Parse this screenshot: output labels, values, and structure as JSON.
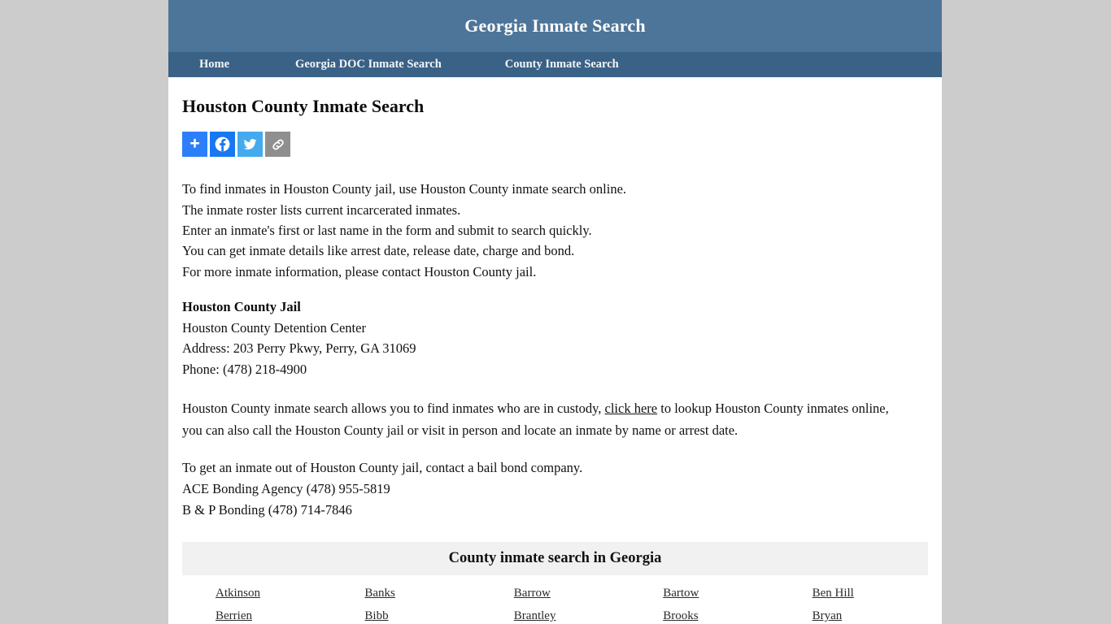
{
  "site": {
    "title": "Georgia Inmate Search",
    "header_bg": "#4d7599",
    "nav_bg": "#3a6186",
    "page_bg": "#cccccc"
  },
  "nav": {
    "items": [
      {
        "label": "Home"
      },
      {
        "label": "Georgia DOC Inmate Search"
      },
      {
        "label": "County Inmate Search"
      }
    ]
  },
  "main": {
    "page_title": "Houston County Inmate Search",
    "share_buttons": [
      {
        "name": "share-icon",
        "label": "Share",
        "color": "#2d7ff9"
      },
      {
        "name": "facebook-icon",
        "label": "Facebook",
        "color": "#1877f2"
      },
      {
        "name": "twitter-icon",
        "label": "Twitter",
        "color": "#44aaee"
      },
      {
        "name": "copy-link-icon",
        "label": "Copy Link",
        "color": "#8f8f8f"
      }
    ],
    "intro_lines": [
      "To find inmates in Houston County jail, use Houston County inmate search online.",
      "The inmate roster lists current incarcerated inmates.",
      "Enter an inmate's first or last name in the form and submit to search quickly.",
      "You can get inmate details like arrest date, release date, charge and bond.",
      "For more inmate information, please contact Houston County jail."
    ],
    "jail": {
      "name": "Houston County Jail",
      "facility": "Houston County Detention Center",
      "address": "Address: 203 Perry Pkwy, Perry, GA 31069",
      "phone": "Phone: (478) 218-4900"
    },
    "search_paragraph": {
      "before_link": "Houston County inmate search allows you to find inmates who are in custody, ",
      "link_text": "click here",
      "after_link": " to lookup Houston County inmates online, you can also call the Houston County jail or visit in person and locate an inmate by name or arrest date."
    },
    "bond": {
      "intro": "To get an inmate out of Houston County jail, contact a bail bond company.",
      "agencies": [
        "ACE Bonding Agency (478) 955-5819",
        "B & P Bonding (478) 714-7846"
      ]
    }
  },
  "county_table": {
    "heading": "County inmate search in Georgia",
    "counties": [
      "Atkinson",
      "Banks",
      "Barrow",
      "Bartow",
      "Ben Hill",
      "Berrien",
      "Bibb",
      "Brantley",
      "Brooks",
      "Bryan"
    ]
  }
}
